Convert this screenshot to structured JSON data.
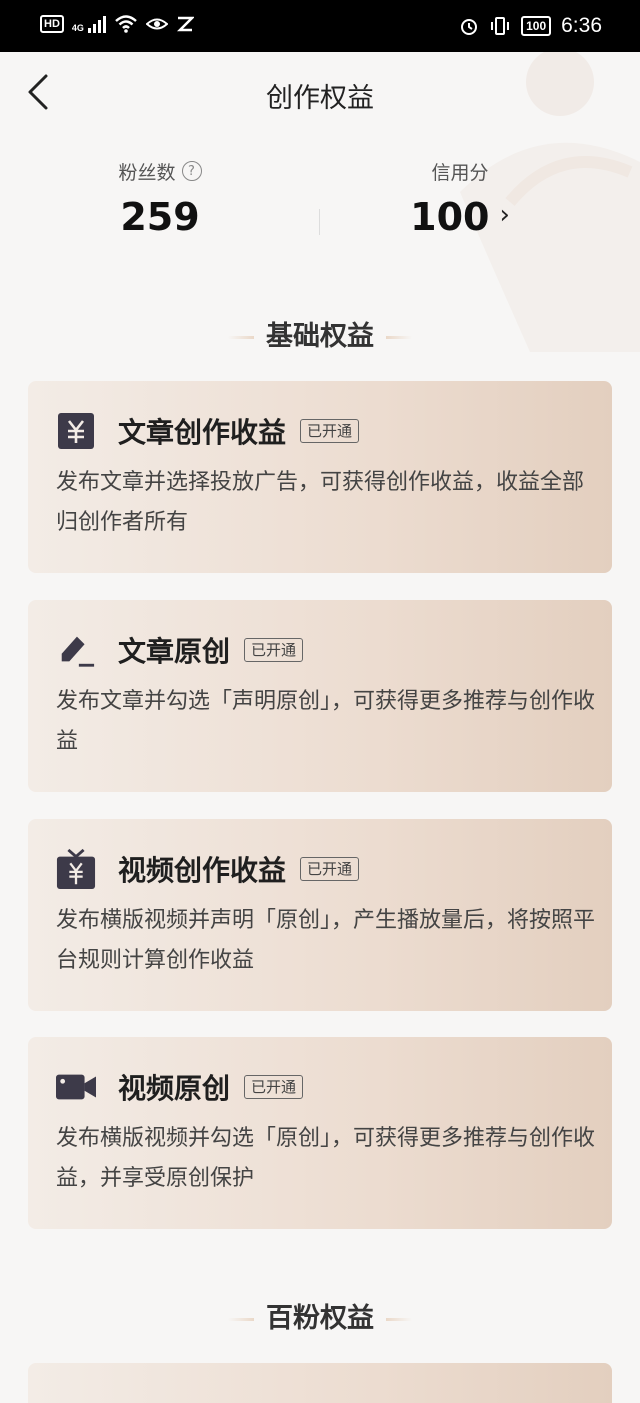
{
  "status_bar": {
    "hd": "HD",
    "network": "4G",
    "battery": "100",
    "time": "6:36"
  },
  "header": {
    "title": "创作权益"
  },
  "stats": {
    "fans_label": "粉丝数",
    "fans_value": "259",
    "help_glyph": "?",
    "credit_label": "信用分",
    "credit_value": "100",
    "credit_chevron": "›"
  },
  "sections": {
    "basic": "基础权益",
    "hundred_fans": "百粉权益"
  },
  "cards": [
    {
      "icon": "yuan-card-icon",
      "title": "文章创作收益",
      "badge": "已开通",
      "desc": "发布文章并选择投放广告，可获得创作收益，收益全部归创作者所有"
    },
    {
      "icon": "pen-icon",
      "title": "文章原创",
      "badge": "已开通",
      "desc": "发布文章并勾选「声明原创」，可获得更多推荐与创作收益"
    },
    {
      "icon": "tv-yuan-icon",
      "title": "视频创作收益",
      "badge": "已开通",
      "desc": "发布横版视频并声明「原创」，产生播放量后，将按照平台规则计算创作收益"
    },
    {
      "icon": "video-camera-icon",
      "title": "视频原创",
      "badge": "已开通",
      "desc": "发布横版视频并勾选「原创」，可获得更多推荐与创作收益，并享受原创保护"
    }
  ],
  "colors": {
    "icon": "#3d3a49",
    "card_start": "#f3ece6",
    "card_end": "#e3cfbf",
    "accent_line": "#ead8c8"
  }
}
